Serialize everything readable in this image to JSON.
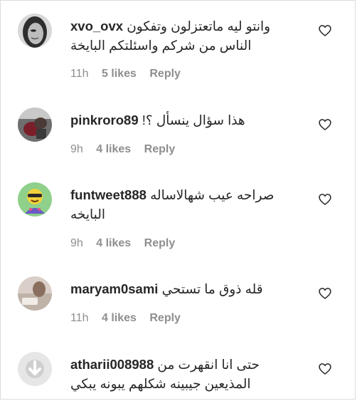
{
  "comments": [
    {
      "username": "xvo_ovx",
      "line1": "وانتو ليه ماتعتزلون وتفكون",
      "line2": "الناس من شركم واسئلتكم البايخة",
      "time": "11h",
      "likes": "5 likes",
      "reply": "Reply"
    },
    {
      "username": "pinkroro89",
      "line1": "هذا سؤال ينسأل ؟!",
      "time": "9h",
      "likes": "4 likes",
      "reply": "Reply"
    },
    {
      "username": "funtweet888",
      "line1": "صراحه عيب شهالاساله",
      "line2": "البايخه",
      "time": "9h",
      "likes": "4 likes",
      "reply": "Reply"
    },
    {
      "username": "maryam0sami",
      "line1": "قله ذوق ما تستحي",
      "time": "11h",
      "likes": "4 likes",
      "reply": "Reply"
    },
    {
      "username": "atharii008988",
      "line1": "حتى انا انقهرت من",
      "line2": "المذيعين جيبينه شكلهم يبونه يبكي"
    }
  ],
  "icons": {
    "like": "heart-outline-icon",
    "default_avatar": "download-arrow-icon"
  },
  "colors": {
    "text": "#262626",
    "meta": "#8e8e8e",
    "border": "#dbdbdb"
  }
}
